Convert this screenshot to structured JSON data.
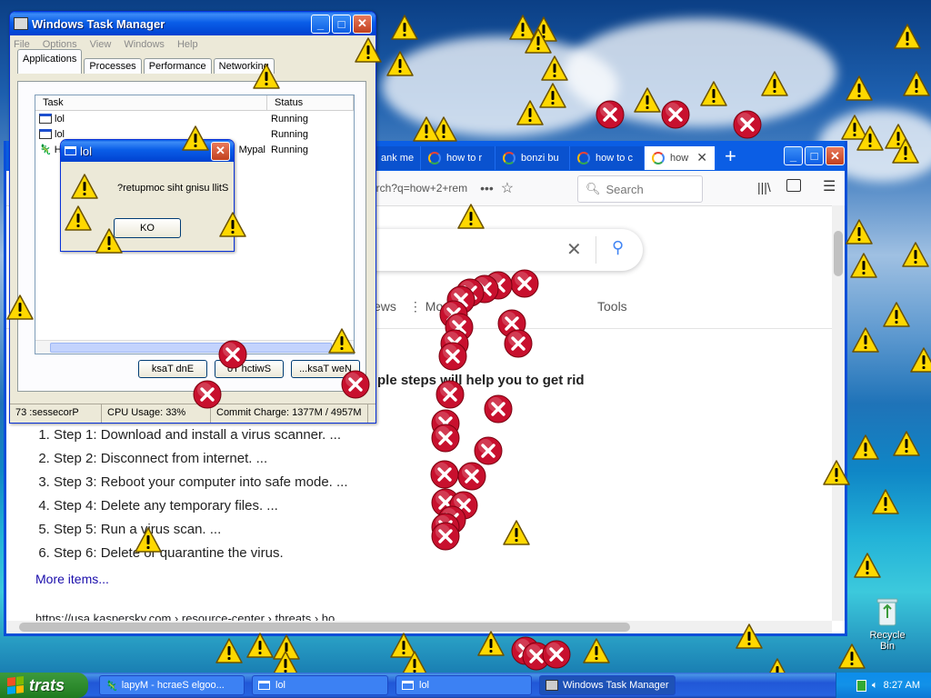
{
  "desktop": {
    "recycle_bin_label": "Recycle Bin"
  },
  "task_manager": {
    "title": "Windows Task Manager",
    "menu": [
      "File",
      "Options",
      "View",
      "Windows",
      "Help"
    ],
    "tabs": [
      "Applications",
      "Processes",
      "Performance",
      "Networking"
    ],
    "columns": {
      "task": "Task",
      "status": "Status"
    },
    "rows": [
      {
        "task": "lol",
        "status": "Running"
      },
      {
        "task": "lol",
        "status": "Running"
      },
      {
        "task": "H",
        "task_suffix": "Mypal",
        "status": "Running"
      }
    ],
    "buttons": {
      "end_task": "ksaT dnE",
      "switch_to": "oT hctiwS",
      "new_task": "...ksaT weN"
    },
    "status": {
      "processes": "73 :sessecorP",
      "cpu": "CPU Usage: 33%",
      "commit": "Commit Charge: 1377M / 4957M"
    }
  },
  "lol_dialog": {
    "title": "lol",
    "message": "?retupmoc siht gnisu llitS",
    "ok_button": "KO"
  },
  "browser": {
    "tabs": [
      {
        "label": "ank me",
        "active": false
      },
      {
        "label": "how to r",
        "active": false
      },
      {
        "label": "bonzi bu",
        "active": false
      },
      {
        "label": "how to c",
        "active": false
      },
      {
        "label": "how",
        "active": true
      }
    ],
    "url": "arch?q=how+2+rem",
    "search_placeholder": "Search",
    "results_nav": {
      "news": "ews",
      "more": "Mo",
      "tools": "Tools"
    },
    "snippet_heading": "ple steps will help you to get rid",
    "steps": [
      "Step 1: Download and install a virus scanner. ...",
      "Step 2: Disconnect from internet. ...",
      "Step 3: Reboot your computer into safe mode. ...",
      "Step 4: Delete any temporary files. ...",
      "Step 5: Run a virus scan. ...",
      "Step 6: Delete or quarantine the virus."
    ],
    "more_items": "More items...",
    "source_url": "https://usa.kaspersky.com › resource-center › threats › ho..."
  },
  "taskbar": {
    "start_label": "trats",
    "items": [
      "lapyM - hcraeS elgoo...",
      "lol",
      "lol",
      "Windows Task Manager"
    ],
    "clock": "8:27 AM"
  },
  "colors": {
    "xp_blue": "#0a5ee8",
    "warning_yellow": "#ffd800",
    "error_red": "#c8102e"
  }
}
